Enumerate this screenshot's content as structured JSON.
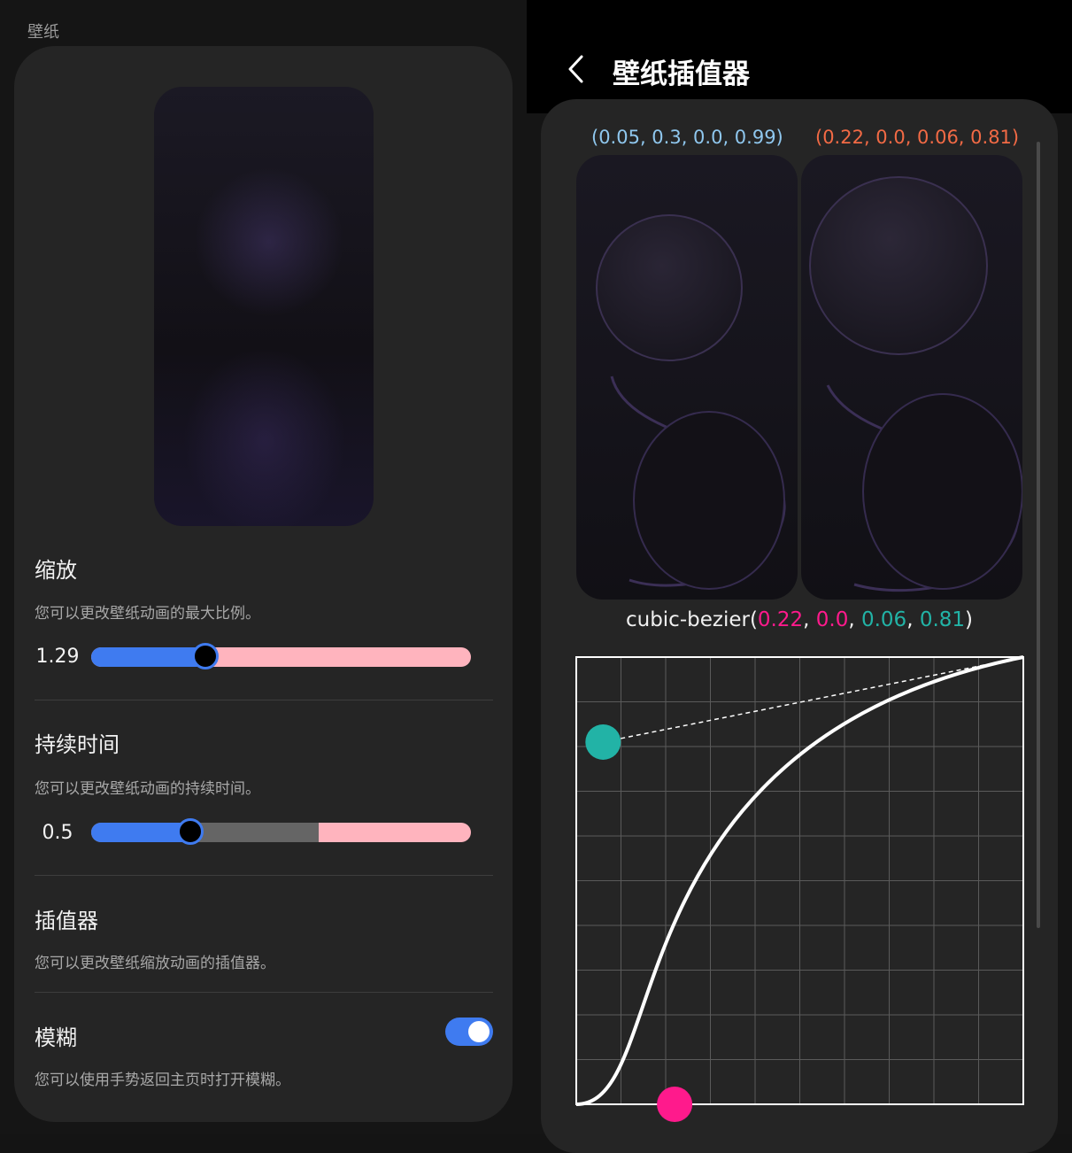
{
  "left": {
    "section_label": "壁纸",
    "scale": {
      "title": "缩放",
      "desc": "您可以更改壁纸动画的最大比例。",
      "value_label": "1.29",
      "fraction": 0.3
    },
    "duration": {
      "title": "持续时间",
      "desc": "您可以更改壁纸动画的持续时间。",
      "value_label": "0.5",
      "fraction": 0.26,
      "buffer_fraction": 0.6
    },
    "interpolator": {
      "title": "插值器",
      "desc": "您可以更改壁纸缩放动画的插值器。"
    },
    "blur": {
      "title": "模糊",
      "desc": "您可以使用手势返回主页时打开模糊。",
      "enabled": true
    }
  },
  "right": {
    "title": "壁纸插值器",
    "preset_a": "(0.05, 0.3, 0.0, 0.99)",
    "preset_b": "(0.22, 0.0, 0.06, 0.81)",
    "bezier": {
      "prefix": "cubic-bezier(",
      "p1x": "0.22",
      "sep1": ", ",
      "p1y": "0.0",
      "sep2": ", ",
      "p2x": "0.06",
      "sep3": ", ",
      "p2y": "0.81",
      "suffix": ")"
    },
    "colors": {
      "preset_a": "#8fc7ee",
      "preset_b": "#f26a45",
      "p1": "#ff1a8c",
      "p2": "#22b3a6",
      "accent": "#3f7bf0"
    }
  }
}
